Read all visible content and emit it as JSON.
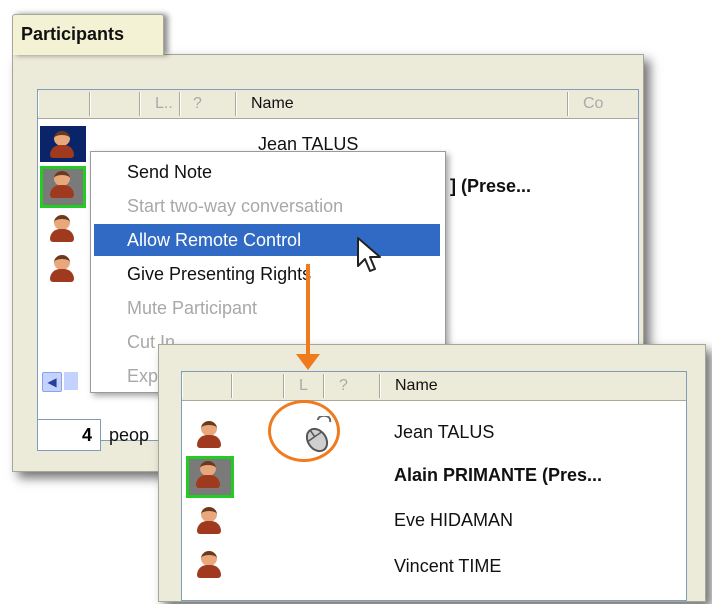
{
  "tab": {
    "label": "Participants"
  },
  "back_list": {
    "columns": [
      "L..",
      "?",
      "Name",
      "Co"
    ],
    "rows": [
      {
        "name": "Jean TALUS"
      },
      {
        "name": "] (Prese..."
      }
    ]
  },
  "context_menu": {
    "items": [
      {
        "label": "Send Note",
        "enabled": true
      },
      {
        "label": "Start two-way conversation",
        "enabled": false
      },
      {
        "label": "Allow Remote Control",
        "enabled": true,
        "highlighted": true
      },
      {
        "label": "Give Presenting Rights",
        "enabled": true
      },
      {
        "label": "Mute Participant",
        "enabled": false
      },
      {
        "label": "Cut In",
        "enabled": false
      },
      {
        "label": "Exp",
        "enabled": false
      }
    ]
  },
  "footer": {
    "count": "4",
    "count_label": "peop"
  },
  "front_list": {
    "columns": [
      "L",
      "?",
      "Name"
    ],
    "rows": [
      {
        "name": "Jean TALUS",
        "bold": false,
        "remote_control": true
      },
      {
        "name": "Alain PRIMANTE (Pres...",
        "bold": true,
        "remote_control": false
      },
      {
        "name": "Eve HIDAMAN",
        "bold": false,
        "remote_control": false
      },
      {
        "name": "Vincent TIME",
        "bold": false,
        "remote_control": false
      }
    ]
  },
  "colors": {
    "accent": "#f07a1e",
    "highlight": "#316ac5",
    "selected_border": "#22cc22"
  }
}
